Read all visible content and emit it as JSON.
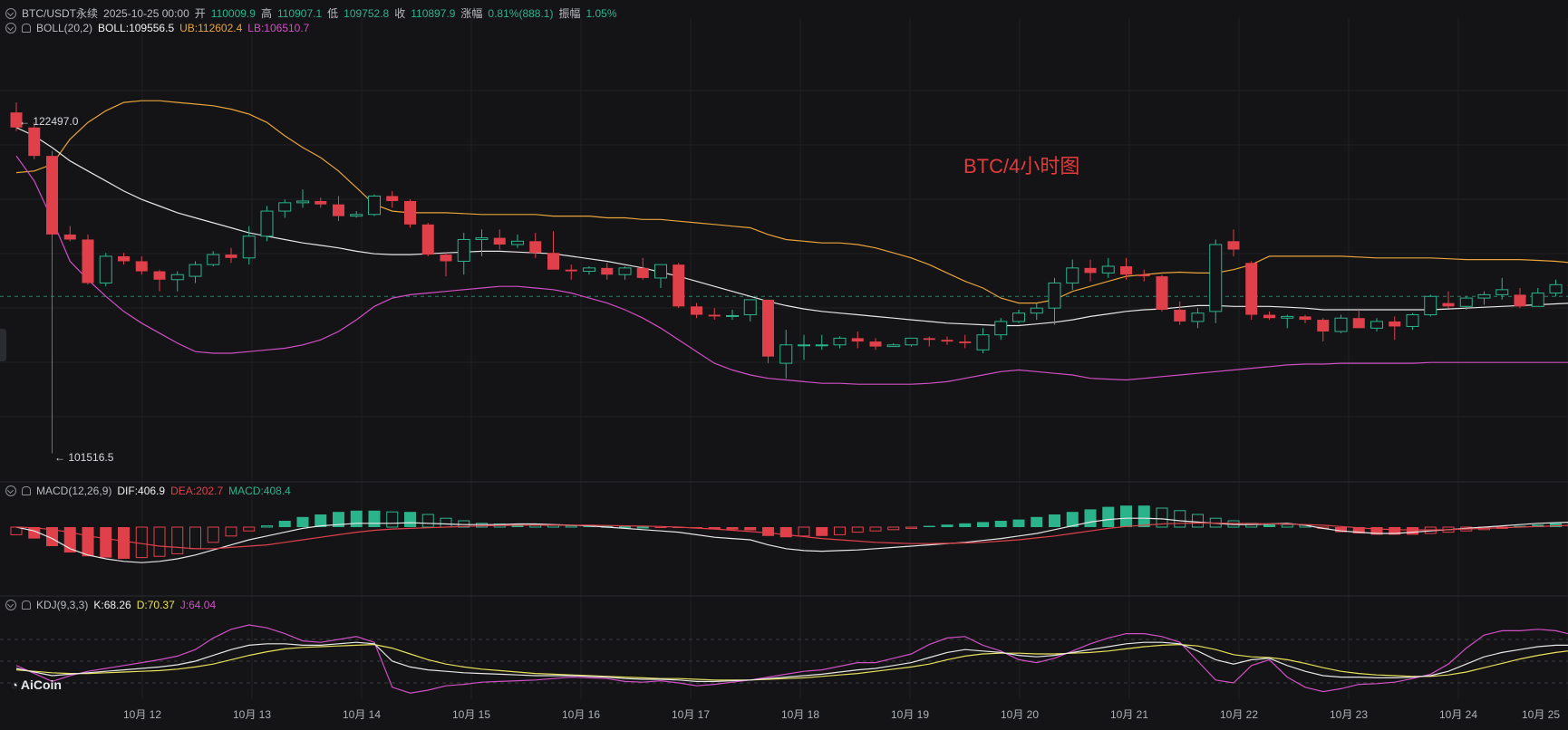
{
  "header": {
    "symbol": "BTC/USDT永续",
    "datetime": "2025-10-25 00:00",
    "open_label": "开",
    "open": "110009.9",
    "high_label": "高",
    "high": "110907.1",
    "low_label": "低",
    "low": "109752.8",
    "close_label": "收",
    "close": "110897.9",
    "change_label": "涨幅",
    "change": "0.81%(888.1)",
    "amp_label": "振幅",
    "amp": "1.05%"
  },
  "boll": {
    "name": "BOLL(20,2)",
    "mid": "BOLL:109556.5",
    "ub": "UB:112602.4",
    "lb": "LB:106510.7"
  },
  "macd": {
    "name": "MACD(12,26,9)",
    "dif": "DIF:406.9",
    "dea": "DEA:202.7",
    "macd": "MACD:408.4"
  },
  "kdj": {
    "name": "KDJ(9,3,3)",
    "k": "K:68.26",
    "d": "D:70.37",
    "j": "J:64.04"
  },
  "annotation": "BTC/4小时图",
  "high_marker": "← 122497.0",
  "low_marker": "← 101516.5",
  "brand": "AiCoin",
  "colors": {
    "up": "#2bb48c",
    "down": "#e0404a",
    "boll_mid": "#e6e6e6",
    "boll_ub": "#e8a33a",
    "boll_lb": "#d04fc4",
    "dif": "#e6e6e6",
    "dea": "#e0404a",
    "k": "#e6e6e6",
    "d": "#e8e05a",
    "j": "#d04fc4"
  },
  "x_ticks": [
    "10月 12",
    "10月 13",
    "10月 14",
    "10月 15",
    "10月 16",
    "10月 17",
    "10月 18",
    "10月 19",
    "10月 20",
    "10月 21",
    "10月 22",
    "10月 23",
    "10月 24",
    "10月 25"
  ],
  "chart_data": {
    "type": "candlestick",
    "interval": "4h",
    "price_range": [
      101000,
      127000
    ],
    "candles": [
      [
        121900,
        122497,
        120800,
        121000
      ],
      [
        121000,
        121300,
        119100,
        119300
      ],
      [
        119300,
        119600,
        101516.5,
        114600
      ],
      [
        114600,
        115100,
        114200,
        114300
      ],
      [
        114300,
        114600,
        111600,
        111700
      ],
      [
        111700,
        113500,
        111500,
        113300
      ],
      [
        113300,
        113500,
        112800,
        113000
      ],
      [
        113000,
        113300,
        112200,
        112400
      ],
      [
        112400,
        112500,
        111200,
        111900
      ],
      [
        111900,
        112400,
        111200,
        112200
      ],
      [
        112100,
        113000,
        111700,
        112800
      ],
      [
        112800,
        113600,
        112700,
        113400
      ],
      [
        113400,
        113800,
        112900,
        113200
      ],
      [
        113200,
        115100,
        112800,
        114500
      ],
      [
        114500,
        116300,
        114200,
        116000
      ],
      [
        116000,
        116700,
        115600,
        116500
      ],
      [
        116500,
        117300,
        116200,
        116600
      ],
      [
        116600,
        116800,
        116200,
        116400
      ],
      [
        116400,
        116900,
        115400,
        115700
      ],
      [
        115700,
        116000,
        115600,
        115800
      ],
      [
        115800,
        117000,
        115700,
        116900
      ],
      [
        116900,
        117200,
        116200,
        116600
      ],
      [
        116600,
        116700,
        115000,
        115200
      ],
      [
        115200,
        115300,
        113300,
        113400
      ],
      [
        113400,
        113500,
        112100,
        113000
      ],
      [
        113000,
        114700,
        112200,
        114300
      ],
      [
        114300,
        114900,
        113300,
        114400
      ],
      [
        114400,
        114900,
        113700,
        114000
      ],
      [
        114000,
        114600,
        113800,
        114200
      ],
      [
        114200,
        114700,
        113200,
        113500
      ],
      [
        113500,
        114800,
        112500,
        112500
      ],
      [
        112500,
        112800,
        111900,
        112400
      ],
      [
        112400,
        112700,
        112200,
        112600
      ],
      [
        112600,
        112900,
        111900,
        112200
      ],
      [
        112200,
        112700,
        111900,
        112600
      ],
      [
        112600,
        113200,
        111900,
        112000
      ],
      [
        112000,
        112800,
        111400,
        112800
      ],
      [
        112800,
        112900,
        110200,
        110300
      ],
      [
        110300,
        110500,
        109600,
        109800
      ],
      [
        109800,
        110200,
        109500,
        109700
      ],
      [
        109700,
        110100,
        109500,
        109750
      ],
      [
        109800,
        110700,
        109400,
        110700
      ],
      [
        110700,
        110700,
        106900,
        107300
      ],
      [
        106900,
        108900,
        106000,
        108000
      ],
      [
        108000,
        108600,
        107100,
        108000
      ],
      [
        108000,
        108600,
        107700,
        108000
      ],
      [
        108000,
        108500,
        107800,
        108400
      ],
      [
        108400,
        108800,
        107800,
        108200
      ],
      [
        108200,
        108400,
        107700,
        107900
      ],
      [
        107900,
        108100,
        107900,
        108000
      ],
      [
        108000,
        108400,
        107900,
        108400
      ],
      [
        108400,
        108500,
        107900,
        108300
      ],
      [
        108300,
        108500,
        108000,
        108200
      ],
      [
        108200,
        108600,
        107800,
        108100
      ],
      [
        107700,
        109000,
        107500,
        108600
      ],
      [
        108600,
        109600,
        108300,
        109400
      ],
      [
        109400,
        110100,
        109300,
        109900
      ],
      [
        109900,
        110500,
        109500,
        110200
      ],
      [
        110200,
        112000,
        109200,
        111700
      ],
      [
        111700,
        113100,
        111300,
        112600
      ],
      [
        112600,
        113100,
        111800,
        112300
      ],
      [
        112300,
        113200,
        112000,
        112700
      ],
      [
        112700,
        113200,
        111900,
        112200
      ],
      [
        112200,
        112500,
        111800,
        112100
      ],
      [
        112100,
        112200,
        110000,
        110100
      ],
      [
        110100,
        110600,
        109200,
        109400
      ],
      [
        109400,
        110200,
        109000,
        109900
      ],
      [
        110000,
        114300,
        109300,
        114000
      ],
      [
        114200,
        114900,
        113300,
        113700
      ],
      [
        112900,
        113000,
        109500,
        109800
      ],
      [
        109800,
        110000,
        109500,
        109600
      ],
      [
        109600,
        109800,
        109000,
        109700
      ],
      [
        109700,
        109800,
        109300,
        109500
      ],
      [
        109500,
        109600,
        108200,
        108800
      ],
      [
        108800,
        109800,
        108700,
        109600
      ],
      [
        109600,
        110100,
        109000,
        109000
      ],
      [
        109000,
        109600,
        108800,
        109400
      ],
      [
        109400,
        109700,
        108300,
        109100
      ],
      [
        109100,
        109900,
        108900,
        109800
      ],
      [
        109800,
        111000,
        109700,
        110900
      ],
      [
        110500,
        111200,
        110200,
        110300
      ],
      [
        110300,
        110900,
        110100,
        110800
      ],
      [
        110800,
        111200,
        110400,
        111000
      ],
      [
        111000,
        112000,
        110700,
        111300
      ],
      [
        111000,
        111400,
        110200,
        110300
      ],
      [
        110300,
        111400,
        110300,
        111100
      ],
      [
        111100,
        111900,
        110900,
        111600
      ],
      [
        111600,
        111900,
        111100,
        111500
      ],
      [
        111500,
        112300,
        111300,
        111700
      ],
      [
        111700,
        111900,
        110700,
        110800
      ],
      [
        110000,
        110907.1,
        109752.8,
        110897.9
      ]
    ],
    "boll_ub": [
      118300,
      118400,
      118800,
      120300,
      121300,
      122000,
      122500,
      122600,
      122600,
      122500,
      122400,
      122300,
      122100,
      121800,
      121300,
      120500,
      119800,
      119200,
      118400,
      117400,
      116400,
      116000,
      115900,
      115900,
      115900,
      115850,
      115800,
      115800,
      115800,
      115800,
      115700,
      115700,
      115700,
      115600,
      115600,
      115500,
      115500,
      115400,
      115300,
      115200,
      115100,
      115000,
      114600,
      114300,
      114200,
      114100,
      114100,
      114000,
      113800,
      113500,
      113200,
      112800,
      112300,
      111800,
      111400,
      110800,
      110500,
      110500,
      110700,
      111200,
      111500,
      111800,
      112100,
      112200,
      112300,
      112350,
      112300,
      112300,
      112500,
      112800,
      113300,
      113300,
      113300,
      113300,
      113300,
      113250,
      113200,
      113200,
      113200,
      113200,
      113150,
      113100,
      113100,
      113100,
      113100,
      113050,
      113000,
      112900,
      112850,
      112800,
      112700,
      112602.4
    ],
    "boll_mid": [
      121000,
      120500,
      119800,
      119000,
      118400,
      117800,
      117200,
      116700,
      116300,
      115900,
      115600,
      115300,
      115000,
      114700,
      114500,
      114300,
      114100,
      113950,
      113800,
      113600,
      113450,
      113400,
      113400,
      113450,
      113500,
      113550,
      113600,
      113600,
      113550,
      113500,
      113450,
      113300,
      113150,
      113000,
      112800,
      112600,
      112350,
      112100,
      111800,
      111500,
      111200,
      110900,
      110600,
      110350,
      110150,
      110000,
      109900,
      109800,
      109700,
      109600,
      109500,
      109400,
      109300,
      109250,
      109200,
      109150,
      109150,
      109250,
      109350,
      109500,
      109700,
      109850,
      110000,
      110100,
      110150,
      110250,
      110350,
      110350,
      110300,
      110300,
      110300,
      110250,
      110200,
      110100,
      110100,
      110100,
      110100,
      110100,
      110100,
      110100,
      110150,
      110200,
      110250,
      110300,
      110350,
      110400,
      110450,
      110500,
      110550,
      110600,
      110600,
      109556.5
    ],
    "boll_lb": [
      119300,
      117800,
      115500,
      113000,
      111900,
      110900,
      110000,
      109300,
      108700,
      108100,
      107600,
      107500,
      107500,
      107600,
      107700,
      107800,
      108000,
      108300,
      108800,
      109500,
      110300,
      110800,
      111000,
      111100,
      111200,
      111300,
      111400,
      111500,
      111500,
      111400,
      111300,
      111100,
      110800,
      110500,
      110100,
      109600,
      109000,
      108300,
      107600,
      106900,
      106500,
      106200,
      106000,
      105900,
      105800,
      105700,
      105700,
      105650,
      105650,
      105650,
      105650,
      105700,
      105800,
      106000,
      106200,
      106400,
      106500,
      106400,
      106300,
      106200,
      106000,
      105950,
      105900,
      106000,
      106100,
      106200,
      106300,
      106400,
      106500,
      106600,
      106700,
      106800,
      106850,
      106850,
      106900,
      106900,
      106900,
      106900,
      106900,
      106950,
      106950,
      106950,
      106950,
      106950,
      106950,
      106950,
      106950,
      106950,
      107000,
      107000,
      107000,
      106510.7
    ],
    "macd_hist": [
      -600,
      -900,
      -1500,
      -2000,
      -2300,
      -2400,
      -2500,
      -2400,
      -2300,
      -2100,
      -1700,
      -1200,
      -700,
      -300,
      100,
      500,
      800,
      1000,
      1200,
      1300,
      1300,
      1200,
      1200,
      1000,
      700,
      500,
      300,
      250,
      250,
      200,
      150,
      100,
      100,
      60,
      40,
      0,
      -50,
      -60,
      -100,
      -150,
      -200,
      -250,
      -700,
      -800,
      -700,
      -700,
      -600,
      -400,
      -300,
      -200,
      -100,
      100,
      200,
      300,
      400,
      500,
      600,
      800,
      1000,
      1200,
      1400,
      1600,
      1700,
      1700,
      1500,
      1300,
      1000,
      700,
      500,
      300,
      300,
      200,
      150,
      -100,
      -400,
      -500,
      -600,
      -600,
      -600,
      -500,
      -400,
      -300,
      -200,
      -100,
      100,
      200,
      300,
      350,
      400,
      400,
      408.4
    ],
    "dif": [
      0,
      -300,
      -900,
      -1700,
      -2200,
      -2500,
      -2700,
      -2800,
      -2700,
      -2500,
      -2200,
      -1800,
      -1400,
      -1000,
      -700,
      -400,
      -100,
      100,
      200,
      300,
      300,
      300,
      350,
      300,
      250,
      200,
      200,
      200,
      250,
      250,
      200,
      150,
      100,
      0,
      -100,
      -200,
      -300,
      -400,
      -600,
      -800,
      -900,
      -1000,
      -1400,
      -1700,
      -1850,
      -1900,
      -1850,
      -1800,
      -1700,
      -1600,
      -1500,
      -1400,
      -1300,
      -1200,
      -1050,
      -900,
      -700,
      -500,
      -200,
      100,
      400,
      600,
      700,
      700,
      650,
      500,
      400,
      300,
      200,
      200,
      250,
      300,
      150,
      -100,
      -300,
      -400,
      -500,
      -500,
      -400,
      -300,
      -200,
      -100,
      0,
      100,
      200,
      300,
      350,
      400,
      420,
      400,
      406.9
    ],
    "dea": [
      0,
      -50,
      -200,
      -400,
      -700,
      -900,
      -1100,
      -1300,
      -1500,
      -1600,
      -1700,
      -1700,
      -1600,
      -1500,
      -1400,
      -1200,
      -1000,
      -800,
      -600,
      -400,
      -250,
      -150,
      -100,
      -50,
      0,
      50,
      100,
      130,
      150,
      150,
      150,
      150,
      150,
      130,
      100,
      80,
      50,
      0,
      -80,
      -150,
      -250,
      -350,
      -450,
      -600,
      -750,
      -900,
      -1000,
      -1100,
      -1200,
      -1250,
      -1300,
      -1300,
      -1280,
      -1250,
      -1200,
      -1100,
      -1000,
      -850,
      -700,
      -500,
      -300,
      -100,
      50,
      150,
      250,
      300,
      320,
      320,
      300,
      280,
      260,
      240,
      200,
      150,
      50,
      -50,
      -150,
      -200,
      -220,
      -220,
      -200,
      -150,
      -100,
      -50,
      0,
      50,
      100,
      150,
      180,
      190,
      202.7
    ],
    "kdj_k": [
      40,
      35,
      30,
      32,
      34,
      36,
      38,
      40,
      42,
      45,
      50,
      58,
      66,
      72,
      74,
      74,
      72,
      72,
      74,
      76,
      74,
      50,
      42,
      38,
      36,
      34,
      33,
      32,
      31,
      30,
      30,
      30,
      29,
      28,
      26,
      25,
      25,
      24,
      22,
      22,
      23,
      24,
      26,
      28,
      30,
      32,
      35,
      38,
      40,
      44,
      48,
      55,
      62,
      66,
      64,
      62,
      58,
      56,
      58,
      62,
      66,
      70,
      74,
      76,
      76,
      74,
      64,
      52,
      46,
      52,
      54,
      44,
      36,
      30,
      28,
      28,
      27,
      27,
      28,
      30,
      36,
      46,
      56,
      62,
      66,
      70,
      72,
      72,
      74,
      68.26
    ],
    "kdj_d": [
      38,
      36,
      34,
      33,
      33,
      34,
      35,
      36,
      37,
      39,
      42,
      46,
      52,
      58,
      63,
      67,
      69,
      70,
      71,
      72,
      73,
      68,
      60,
      52,
      46,
      42,
      39,
      37,
      35,
      33,
      32,
      31,
      30,
      29,
      28,
      27,
      26,
      26,
      25,
      24,
      24,
      24,
      25,
      26,
      27,
      29,
      31,
      33,
      36,
      39,
      42,
      46,
      52,
      57,
      60,
      61,
      61,
      60,
      60,
      61,
      62,
      64,
      67,
      70,
      72,
      73,
      71,
      66,
      59,
      56,
      55,
      52,
      47,
      41,
      36,
      33,
      31,
      30,
      29,
      29,
      31,
      35,
      41,
      47,
      53,
      58,
      62,
      65,
      68,
      70.37
    ],
    "kdj_j": [
      44,
      33,
      22,
      30,
      36,
      40,
      44,
      48,
      52,
      57,
      66,
      82,
      94,
      100,
      96,
      88,
      78,
      76,
      80,
      84,
      76,
      14,
      6,
      10,
      16,
      18,
      21,
      22,
      23,
      24,
      26,
      28,
      27,
      26,
      22,
      21,
      23,
      20,
      16,
      18,
      21,
      24,
      28,
      32,
      36,
      38,
      43,
      48,
      48,
      54,
      60,
      73,
      82,
      84,
      72,
      64,
      52,
      48,
      54,
      64,
      74,
      82,
      88,
      88,
      84,
      76,
      50,
      24,
      20,
      44,
      52,
      28,
      14,
      8,
      12,
      18,
      19,
      21,
      26,
      32,
      46,
      68,
      86,
      92,
      92,
      94,
      92,
      86,
      86,
      64.04
    ]
  }
}
